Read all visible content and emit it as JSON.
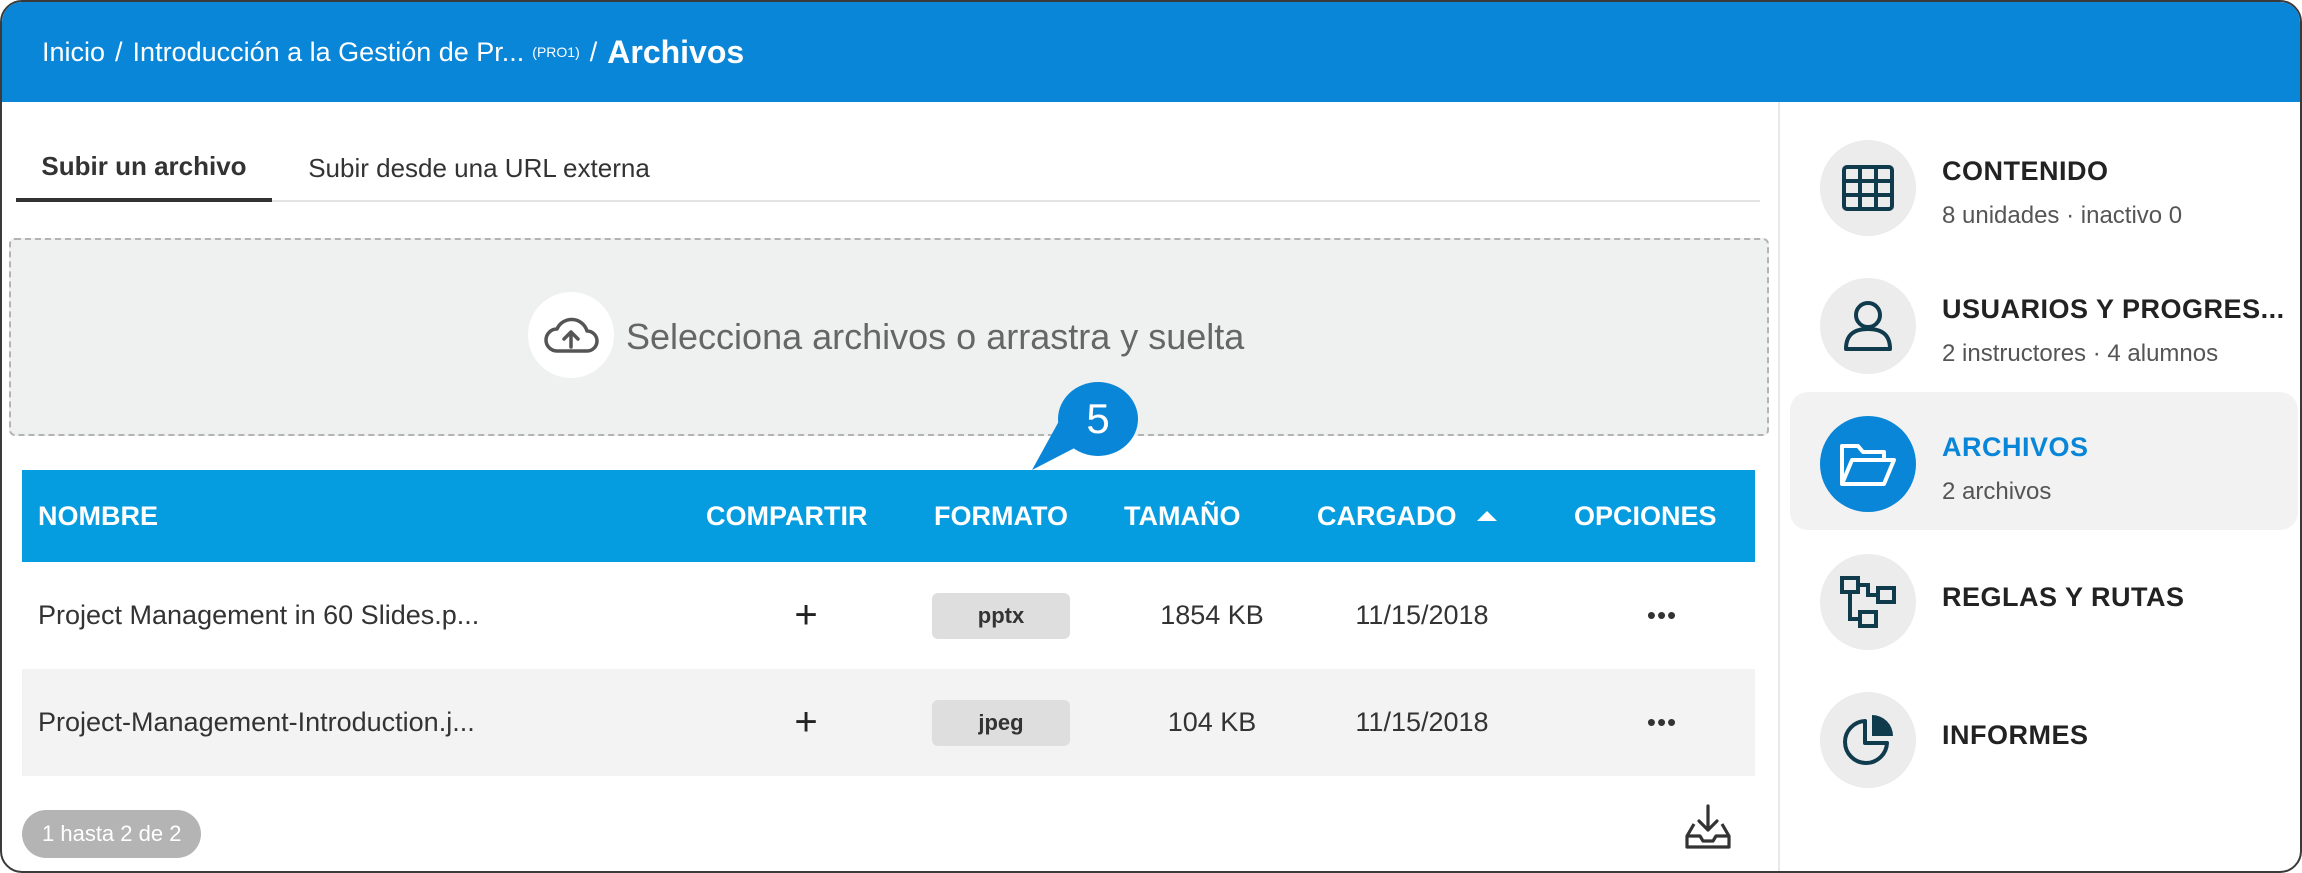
{
  "breadcrumb": {
    "home": "Inicio",
    "course": "Introducción a la Gestión de Pr...",
    "course_code": "(PRO1)",
    "current": "Archivos",
    "separator": "/"
  },
  "tabs": [
    {
      "label": "Subir un archivo",
      "active": true
    },
    {
      "label": "Subir desde una URL externa",
      "active": false
    }
  ],
  "dropzone": {
    "text": "Selecciona archivos o arrastra y suelta",
    "icon": "cloud-upload-icon"
  },
  "callout": {
    "number": "5"
  },
  "table": {
    "headers": {
      "name": "NOMBRE",
      "share": "COMPARTIR",
      "format": "FORMATO",
      "size": "TAMAÑO",
      "uploaded": "CARGADO",
      "options": "OPCIONES"
    },
    "rows": [
      {
        "name": "Project Management in 60 Slides.p...",
        "share": "+",
        "format": "pptx",
        "size": "1854 KB",
        "uploaded": "11/15/2018",
        "options": "•••"
      },
      {
        "name": "Project-Management-Introduction.j...",
        "share": "+",
        "format": "jpeg",
        "size": "104 KB",
        "uploaded": "11/15/2018",
        "options": "•••"
      }
    ]
  },
  "pager": {
    "text": "1 hasta 2 de 2"
  },
  "sidebar": {
    "items": [
      {
        "title": "CONTENIDO",
        "subtitle": "8 unidades · inactivo 0",
        "icon": "grid-icon"
      },
      {
        "title": "USUARIOS Y PROGRES...",
        "subtitle": "2 instructores · 4 alumnos",
        "icon": "user-icon"
      },
      {
        "title": "ARCHIVOS",
        "subtitle": "2 archivos",
        "icon": "folder-open-icon",
        "active": true
      },
      {
        "title": "REGLAS Y RUTAS",
        "subtitle": "",
        "icon": "flow-icon"
      },
      {
        "title": "INFORMES",
        "subtitle": "",
        "icon": "pie-chart-icon"
      }
    ]
  },
  "colors": {
    "primary": "#0a86d8",
    "table_header": "#069ce0",
    "pager": "#b4b4b4"
  }
}
